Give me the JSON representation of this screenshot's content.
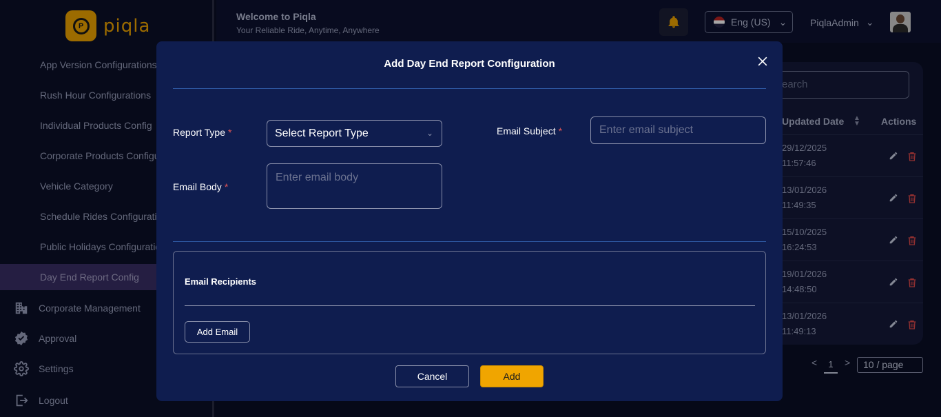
{
  "brand": {
    "name": "piqla"
  },
  "sidebar": {
    "sub_items": [
      {
        "label": "App Version Configurations"
      },
      {
        "label": "Rush Hour Configurations"
      },
      {
        "label": "Individual Products Config"
      },
      {
        "label": "Corporate Products Configu"
      },
      {
        "label": "Vehicle Category"
      },
      {
        "label": "Schedule Rides Configuratio"
      },
      {
        "label": "Public Holidays Configuratio"
      },
      {
        "label": "Day End Report Config"
      }
    ],
    "main_items": [
      {
        "label": "Corporate Management",
        "icon": "building-icon"
      },
      {
        "label": "Approval",
        "icon": "badge-check-icon"
      },
      {
        "label": "Settings",
        "icon": "gear-icon"
      },
      {
        "label": "Logout",
        "icon": "logout-icon"
      }
    ]
  },
  "header": {
    "welcome": "Welcome to Piqla",
    "tagline": "Your Reliable Ride, Anytime, Anywhere",
    "language": "Eng (US)",
    "user": "PiqlaAdmin"
  },
  "table": {
    "search_placeholder": "earch",
    "columns": [
      "Updated Date",
      "Actions"
    ],
    "rows": [
      {
        "date": "29/12/2025",
        "time": "11:57:46"
      },
      {
        "date": "13/01/2026",
        "time": "11:49:35"
      },
      {
        "date": "15/10/2025",
        "time": "16:24:53"
      },
      {
        "date": "19/01/2026",
        "time": "14:48:50"
      },
      {
        "date": "13/01/2026",
        "time": "11:49:13"
      }
    ],
    "pagination": {
      "prev": "<",
      "page": "1",
      "next": ">",
      "per_page": "10 / page"
    }
  },
  "modal": {
    "title": "Add Day End Report Configuration",
    "report_type_label": "Report Type",
    "report_type_value": "Select Report Type",
    "email_subject_label": "Email Subject",
    "email_subject_placeholder": "Enter email subject",
    "email_body_label": "Email Body",
    "email_body_placeholder": "Enter email body",
    "required_mark": "*",
    "recipients_title": "Email Recipients",
    "add_email_label": "Add Email",
    "cancel_label": "Cancel",
    "add_label": "Add"
  },
  "colors": {
    "accent": "#f0a500",
    "modal_bg": "#0f1d4f",
    "required": "#e25555",
    "delete": "#e24a4a"
  }
}
